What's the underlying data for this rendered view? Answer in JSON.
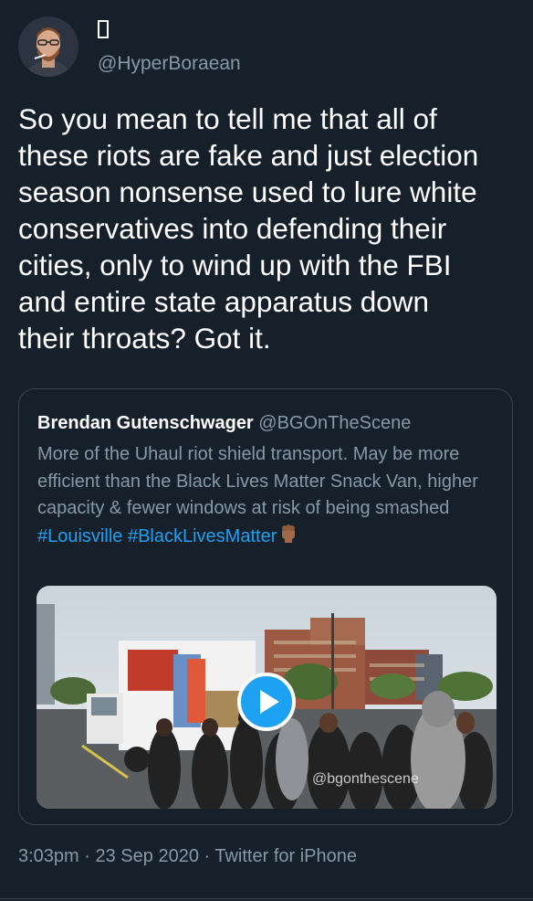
{
  "author": {
    "display_name": "",
    "handle": "@HyperBoraean"
  },
  "tweet": {
    "text": "So you mean to tell me that all of\nthese riots are fake and just election\nseason nonsense used to lure white\nconservatives into defending their\ncities, only to wind up with the FBI\nand entire state apparatus down\ntheir throats? Got it."
  },
  "quote": {
    "name": "Brendan Gutenschwager",
    "handle": "@BGOnTheScene",
    "text_before": "More of the Uhaul riot shield transport. May be more efficient than the Black Lives Matter Snack Van, higher capacity & fewer windows at risk of being smashed ",
    "hashtag_1": "#Louisville",
    "hashtag_2": "#BlackLivesMatter",
    "emoji": "raised-fist-medium-dark-skin-icon",
    "media": {
      "watermark": "@bgonthescene",
      "play_icon": "play-icon"
    }
  },
  "meta": {
    "time": "3:03pm",
    "sep1": " · ",
    "date": "23 Sep 2020",
    "sep2": " · ",
    "source": "Twitter for iPhone"
  },
  "colors": {
    "background": "#15202b",
    "secondary_text": "#8899a6",
    "link": "#1da1f2",
    "border": "#38444d"
  }
}
